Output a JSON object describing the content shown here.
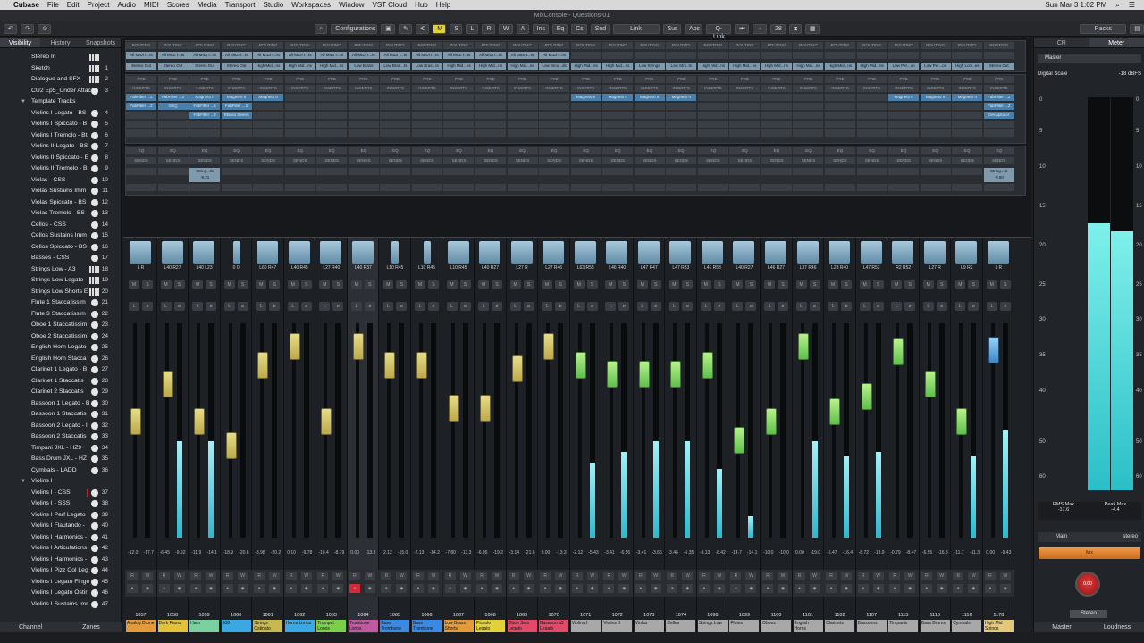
{
  "menubar": {
    "app": "Cubase",
    "items": [
      "File",
      "Edit",
      "Project",
      "Audio",
      "MIDI",
      "Scores",
      "Media",
      "Transport",
      "Studio",
      "Workspaces",
      "Window",
      "VST Cloud",
      "Hub",
      "Help"
    ],
    "clock": "Sun Mar 3  1:02 PM"
  },
  "window": {
    "title": "MixConsole - Questions-01"
  },
  "toolbar": {
    "configurations": "Configurations",
    "m": "M",
    "s": "S",
    "l": "L",
    "r": "R",
    "w": "W",
    "a": "A",
    "ins": "Ins",
    "eq": "Eq",
    "cs": "Cs",
    "snd": "Snd",
    "link": "Link",
    "sus": "Sus",
    "abs": "Abs",
    "qlink": "Q-Link",
    "count": "28",
    "racks": "Racks"
  },
  "leftpanel": {
    "tabs": [
      "Visibility",
      "History",
      "Snapshots"
    ],
    "bottom_tabs": [
      "Channel",
      "Zones"
    ],
    "tracks": [
      {
        "name": "Stereo In",
        "num": "",
        "kind": "kb"
      },
      {
        "name": "Sketch",
        "num": "1",
        "kind": "kb"
      },
      {
        "name": "Dialogue and SFX",
        "num": "2",
        "kind": "kb"
      },
      {
        "name": "CU2 Ep5_Under Attac",
        "num": "3",
        "kind": "chk"
      },
      {
        "name": "Template Tracks",
        "num": "",
        "kind": "folder"
      },
      {
        "name": "Violins I Legato - BS",
        "num": "4",
        "kind": "chk"
      },
      {
        "name": "Violins I Spiccato - B",
        "num": "5",
        "kind": "chk"
      },
      {
        "name": "Violins I Tremolo - Bt",
        "num": "6",
        "kind": "chk"
      },
      {
        "name": "Violins II Legato - BS",
        "num": "7",
        "kind": "chk"
      },
      {
        "name": "Violins II Spiccato - E",
        "num": "8",
        "kind": "chk"
      },
      {
        "name": "Violins II Tremolo - B",
        "num": "9",
        "kind": "chk"
      },
      {
        "name": "Violas - CSS",
        "num": "10",
        "kind": "chk"
      },
      {
        "name": "Violas Sustains Imm",
        "num": "11",
        "kind": "chk"
      },
      {
        "name": "Violas Spiccato - BS",
        "num": "12",
        "kind": "chk"
      },
      {
        "name": "Violas Tremolo - BS",
        "num": "13",
        "kind": "chk"
      },
      {
        "name": "Cellos - CSS",
        "num": "14",
        "kind": "chk"
      },
      {
        "name": "Cellos Sustains Imm",
        "num": "15",
        "kind": "chk"
      },
      {
        "name": "Cellos Spiccato - BS",
        "num": "16",
        "kind": "chk"
      },
      {
        "name": "Basses - CSS",
        "num": "17",
        "kind": "chk"
      },
      {
        "name": "Strings Low - A3",
        "num": "18",
        "kind": "kb"
      },
      {
        "name": "Strings Low Legato",
        "num": "19",
        "kind": "kb"
      },
      {
        "name": "Strings Low Shorts E",
        "num": "20",
        "kind": "kb"
      },
      {
        "name": "Flute 1 Staccatissim",
        "num": "21",
        "kind": "chk"
      },
      {
        "name": "Flute 3 Staccatissim",
        "num": "22",
        "kind": "chk"
      },
      {
        "name": "Oboe 1 Staccatissim",
        "num": "23",
        "kind": "chk"
      },
      {
        "name": "Oboe 2 Staccatissim",
        "num": "24",
        "kind": "chk"
      },
      {
        "name": "English Horn Legato",
        "num": "25",
        "kind": "chk"
      },
      {
        "name": "English Horn Stacca",
        "num": "26",
        "kind": "chk"
      },
      {
        "name": "Clarinet 1 Legato - B",
        "num": "27",
        "kind": "chk"
      },
      {
        "name": "Clarinet 1 Staccatis",
        "num": "28",
        "kind": "chk"
      },
      {
        "name": "Clarinet 2 Staccatis",
        "num": "29",
        "kind": "chk"
      },
      {
        "name": "Bassoon 1 Legato - B",
        "num": "30",
        "kind": "chk"
      },
      {
        "name": "Bassoon 1 Staccatis",
        "num": "31",
        "kind": "chk"
      },
      {
        "name": "Bassoon 2 Legato - I",
        "num": "32",
        "kind": "chk"
      },
      {
        "name": "Bassoon 2 Staccatis",
        "num": "33",
        "kind": "chk"
      },
      {
        "name": "Timpani JXL - HZ9",
        "num": "34",
        "kind": "chk"
      },
      {
        "name": "Bass Drum JXL - HZ",
        "num": "35",
        "kind": "chk"
      },
      {
        "name": "Cymbals - LADD",
        "num": "36",
        "kind": "chk"
      },
      {
        "name": "Violins I",
        "num": "",
        "kind": "folder"
      },
      {
        "name": "Violins I - CSS",
        "num": "37",
        "kind": "red"
      },
      {
        "name": "Violins I - SSS",
        "num": "38",
        "kind": "chk"
      },
      {
        "name": "Violins I Perf Legato",
        "num": "39",
        "kind": "chk"
      },
      {
        "name": "Violins I Flautando -",
        "num": "40",
        "kind": "chk"
      },
      {
        "name": "Violins I Harmonics -",
        "num": "41",
        "kind": "chk"
      },
      {
        "name": "Violins I Articulations",
        "num": "42",
        "kind": "chk"
      },
      {
        "name": "Violins I Harmonics -",
        "num": "43",
        "kind": "chk"
      },
      {
        "name": "Violins I Pizz Col Leg",
        "num": "44",
        "kind": "chk"
      },
      {
        "name": "Violins I Legato Finge",
        "num": "45",
        "kind": "chk"
      },
      {
        "name": "Violins I Legato Ostir",
        "num": "46",
        "kind": "chk"
      },
      {
        "name": "Violins I Sustains Imr",
        "num": "47",
        "kind": "chk"
      }
    ]
  },
  "mixer": {
    "routing_label": "ROUTING",
    "inserts_label": "INSERTS",
    "sends_label": "SENDS",
    "pre_label": "PRE",
    "eq_label": "EQ",
    "routing_row1": [
      "All MIDI I...ts",
      "All MIDI I...ts",
      "All MIDI I...ts",
      "All MIDI I...ts",
      "All MIDI I...ts",
      "All MIDI I...ts",
      "All MIDI I...ts",
      "All MIDI I...ts",
      "All MIDI I...ts",
      "All MIDI I...ts",
      "All MIDI I...ts",
      "All MIDI I...ts",
      "All MIDI I...ts",
      "All MIDI I...ts"
    ],
    "routing_row2": [
      "Stereo Out",
      "Stereo Out",
      "Stereo Out",
      "Stereo Out",
      "High Mid...ns",
      "High Mid...ns",
      "High Mid...ns",
      "Low Brass",
      "Low Bras...ts",
      "Low Bras...ts",
      "High Mid...ns",
      "High Mid...ns",
      "High Mid...ns",
      "Low Woo...ds",
      "High Mid...ns",
      "High Mid...ns",
      "Low Strings",
      "Low Stri...ts",
      "High Mid...ns",
      "High Mid...ns",
      "High Mid...ns",
      "High Mid...ns",
      "High Mid...ns",
      "High Mid...ns",
      "Low Per...on",
      "Low Per...on",
      "High Lon...es",
      "Stereo Out"
    ],
    "inserts_row1": [
      "FabFilter ...2",
      "FabFilter ...2",
      "Magneto II",
      "Magneto II",
      "Magneto II",
      "",
      "",
      "",
      "",
      "",
      "",
      "",
      "",
      "",
      "Magneto II",
      "Magneto II",
      "Magneto II",
      "Magneto II",
      "",
      "",
      "",
      "",
      "",
      "",
      "Magneto II",
      "Magneto II",
      "Magneto II",
      "FabFilter ...2"
    ],
    "inserts_row2": [
      "FabFilter ...2",
      "Gst()",
      "FabFilter ...2",
      "FabFilter ...2",
      "",
      "",
      "",
      "",
      "",
      "",
      "",
      "",
      "",
      "",
      "",
      "",
      "",
      "",
      "",
      "",
      "",
      "",
      "",
      "",
      "",
      "",
      "",
      "FabFilter ...2"
    ],
    "inserts_row3": [
      "",
      "",
      "FabFilter ...2",
      "RBass Stereo",
      "",
      "",
      "",
      "",
      "",
      "",
      "",
      "",
      "",
      "",
      "",
      "",
      "",
      "",
      "",
      "",
      "",
      "",
      "",
      "",
      "",
      "",
      "",
      "Decapitator"
    ],
    "sends": [
      {
        "ch": 3,
        "name": "String...rb",
        "val": "-9.21"
      },
      {
        "ch": 28,
        "name": "String...rb",
        "val": "-5.50"
      }
    ],
    "channels": [
      {
        "num": "1057",
        "name": "Analog Drone",
        "color": "#e39a3a",
        "pan": "L R",
        "val": "-12.0",
        "val2": "-17.7",
        "fader": 0.55,
        "meter": 0,
        "type": "yellow",
        "rec": false
      },
      {
        "num": "1058",
        "name": "Dark Piano",
        "color": "#e3c23a",
        "pan": "L40 R27",
        "val": "-6.45",
        "val2": "-9.92",
        "fader": 0.75,
        "meter": 0.45,
        "type": "yellow",
        "rec": false
      },
      {
        "num": "1059",
        "name": "Harp",
        "color": "#7ad0a0",
        "pan": "L40 L23",
        "val": "-11.9",
        "val2": "-14.1",
        "fader": 0.55,
        "meter": 0.45,
        "type": "yellow",
        "rec": false
      },
      {
        "num": "1060",
        "name": "808",
        "color": "#3aa8e3",
        "pan": "0 0",
        "val": "-18.9",
        "val2": "-20.6",
        "fader": 0.42,
        "meter": 0,
        "type": "yellow",
        "rec": false
      },
      {
        "num": "1061",
        "name": "Strings Ostinato",
        "color": "#c8b850",
        "pan": "L60 R47",
        "val": "-3.98",
        "val2": "-20.2",
        "fader": 0.85,
        "meter": 0,
        "type": "yellow",
        "rec": false
      },
      {
        "num": "1062",
        "name": "Horns Lonos",
        "color": "#3aa8e3",
        "pan": "L40 R45",
        "val": "0.10",
        "val2": "-9.78",
        "fader": 0.95,
        "meter": 0,
        "type": "yellow",
        "rec": false
      },
      {
        "num": "1063",
        "name": "Trumpet Lonos",
        "color": "#7ad04a",
        "pan": "L27 R40",
        "val": "-10.4",
        "val2": "-8.79",
        "fader": 0.55,
        "meter": 0,
        "type": "yellow",
        "rec": false
      },
      {
        "num": "1064",
        "name": "Trombone Lonos",
        "color": "#c05aa0",
        "pan": "L40 R37",
        "val": "0.00",
        "val2": "-13.8",
        "fader": 0.95,
        "meter": 0,
        "type": "yellow",
        "rec": true
      },
      {
        "num": "1065",
        "name": "Bass Trombone",
        "color": "#3a8ae3",
        "pan": "L10 R45",
        "val": "-2.12",
        "val2": "-15.0",
        "fader": 0.85,
        "meter": 0,
        "type": "yellow",
        "rec": false
      },
      {
        "num": "1066",
        "name": "Bass Trombone",
        "color": "#3a8ae3",
        "pan": "L10 R45",
        "val": "-2.13",
        "val2": "-14.2",
        "fader": 0.85,
        "meter": 0,
        "type": "yellow",
        "rec": false
      },
      {
        "num": "1067",
        "name": "Low Brass Shorts",
        "color": "#e39a3a",
        "pan": "L10 R45",
        "val": "-7.80",
        "val2": "-13.3",
        "fader": 0.62,
        "meter": 0,
        "type": "yellow",
        "rec": false
      },
      {
        "num": "1068",
        "name": "Piccolo Legato",
        "color": "#e3d13a",
        "pan": "L40 R27",
        "val": "-6.05",
        "val2": "-19.2",
        "fader": 0.62,
        "meter": 0,
        "type": "yellow",
        "rec": false
      },
      {
        "num": "1069",
        "name": "Oboe Solo Legato",
        "color": "#e34a6a",
        "pan": "L27 R",
        "val": "-3.14",
        "val2": "-21.6",
        "fader": 0.83,
        "meter": 0,
        "type": "yellow",
        "rec": false
      },
      {
        "num": "1070",
        "name": "Bassoon a3 Legato",
        "color": "#e34a6a",
        "pan": "L27 R46",
        "val": "0.00",
        "val2": "-13.3",
        "fader": 0.95,
        "meter": 0,
        "type": "yellow",
        "rec": false
      },
      {
        "num": "1071",
        "name": "Violins I",
        "color": "#a8a8a8",
        "pan": "L63 R55",
        "val": "-2.12",
        "val2": "-5.43",
        "fader": 0.85,
        "meter": 0.35,
        "type": "green",
        "rec": false
      },
      {
        "num": "1072",
        "name": "Violins II",
        "color": "#a8a8a8",
        "pan": "L46 R40",
        "val": "-3.41",
        "val2": "-6.56",
        "fader": 0.8,
        "meter": 0.4,
        "type": "green",
        "rec": false
      },
      {
        "num": "1073",
        "name": "Violas",
        "color": "#a8a8a8",
        "pan": "L47 R47",
        "val": "-3.41",
        "val2": "-3.66",
        "fader": 0.8,
        "meter": 0.45,
        "type": "green",
        "rec": false
      },
      {
        "num": "1074",
        "name": "Celles",
        "color": "#a8a8a8",
        "pan": "L47 R53",
        "val": "-3.46",
        "val2": "-6.35",
        "fader": 0.8,
        "meter": 0.45,
        "type": "green",
        "rec": false
      },
      {
        "num": "1098",
        "name": "Strings Low",
        "color": "#a8a8a8",
        "pan": "L47 R53",
        "val": "-3.13",
        "val2": "-8.42",
        "fader": 0.85,
        "meter": 0.32,
        "type": "green",
        "rec": false
      },
      {
        "num": "1099",
        "name": "Flutes",
        "color": "#a8a8a8",
        "pan": "L40 R27",
        "val": "-14.7",
        "val2": "-14.1",
        "fader": 0.45,
        "meter": 0.1,
        "type": "green",
        "rec": false
      },
      {
        "num": "1100",
        "name": "Oboes",
        "color": "#a8a8a8",
        "pan": "L46 R27",
        "val": "-10.0",
        "val2": "-10.0",
        "fader": 0.55,
        "meter": 0,
        "type": "green",
        "rec": false
      },
      {
        "num": "1101",
        "name": "English Horns",
        "color": "#a8a8a8",
        "pan": "L37 R46",
        "val": "0.00",
        "val2": "-19.0",
        "fader": 0.95,
        "meter": 0.45,
        "type": "green",
        "rec": false
      },
      {
        "num": "1102",
        "name": "Clarinets",
        "color": "#a8a8a8",
        "pan": "L23 R40",
        "val": "-6.47",
        "val2": "-16.4",
        "fader": 0.6,
        "meter": 0.38,
        "type": "green",
        "rec": false
      },
      {
        "num": "1107",
        "name": "Bassoons",
        "color": "#a8a8a8",
        "pan": "L47 R52",
        "val": "-8.72",
        "val2": "-13.9",
        "fader": 0.68,
        "meter": 0.4,
        "type": "green",
        "rec": false
      },
      {
        "num": "1115",
        "name": "Timpanis",
        "color": "#a8a8a8",
        "pan": "R2 R52",
        "val": "-0.79",
        "val2": "-8.47",
        "fader": 0.92,
        "meter": 0,
        "type": "green",
        "rec": false
      },
      {
        "num": "1116",
        "name": "Bass Drums",
        "color": "#a8a8a8",
        "pan": "L27 R",
        "val": "-6.55",
        "val2": "-16.8",
        "fader": 0.75,
        "meter": 0,
        "type": "green",
        "rec": false
      },
      {
        "num": "1116",
        "name": "Cymbals",
        "color": "#a8a8a8",
        "pan": "L9 R2",
        "val": "-11.7",
        "val2": "-11.3",
        "fader": 0.55,
        "meter": 0.38,
        "type": "green",
        "rec": false
      },
      {
        "num": "1178",
        "name": "High Mid Strings",
        "color": "#e3c87a",
        "pan": "L R",
        "val": "0.00",
        "val2": "-9.43",
        "fader": 0.93,
        "meter": 0.5,
        "type": "blue",
        "rec": false
      }
    ]
  },
  "rightpanel": {
    "tabs": [
      "CR",
      "Meter"
    ],
    "master": "Master",
    "digital_scale": "Digital Scale",
    "dbfs": "-18 dBFS",
    "scale_marks": [
      "0",
      "5",
      "10",
      "15",
      "20",
      "25",
      "30",
      "35",
      "40",
      "50",
      "60"
    ],
    "level_l": 0.68,
    "level_r": 0.66,
    "rms_label": "RMS Max",
    "rms_val": "-17.6",
    "peak_label": "Peak Max",
    "peak_val": "-4.4",
    "main": "Main",
    "main_mode": "stereo",
    "knob": "0.00",
    "mix": "Mix",
    "stereo": "Stereo",
    "bottom_tabs": [
      "Master",
      "Loudness"
    ]
  },
  "colors": {
    "accent": "#e3d135",
    "meter": "#2bb9cf",
    "rec": "#d52a33"
  }
}
